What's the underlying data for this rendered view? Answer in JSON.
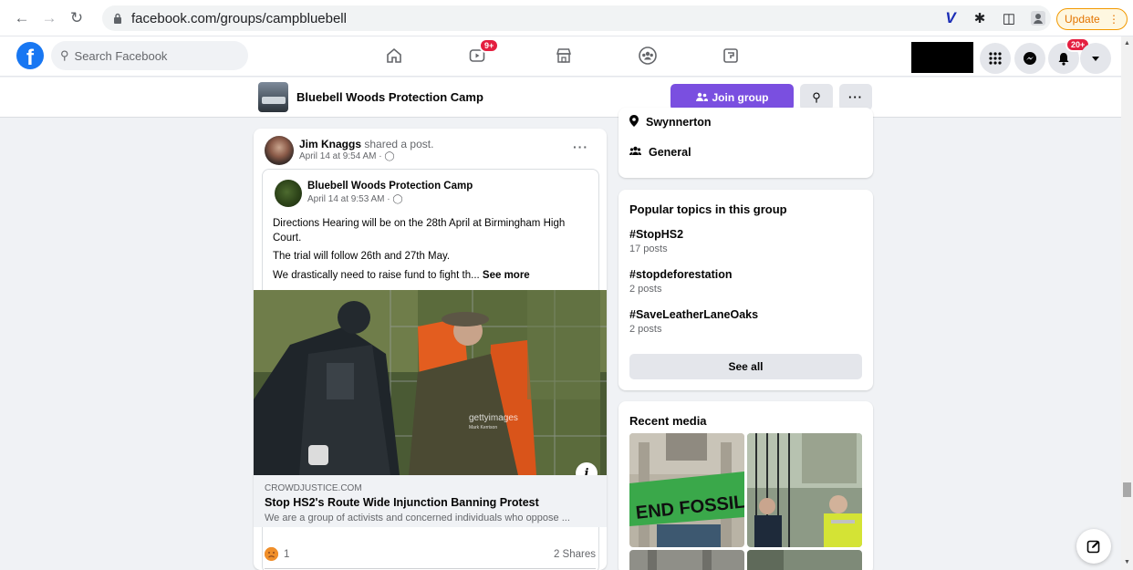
{
  "browser": {
    "url": "facebook.com/groups/campbluebell",
    "update_label": "Update"
  },
  "fb": {
    "search_placeholder": "Search Facebook",
    "watch_badge": "9+",
    "notif_badge": "20+"
  },
  "group": {
    "name": "Bluebell Woods Protection Camp",
    "join_label": "Join group"
  },
  "post": {
    "author": "Jim Knaggs",
    "action": "shared a post.",
    "time": "April 14 at 9:54 AM ·",
    "shared": {
      "author": "Bluebell Woods Protection Camp",
      "time": "April 14 at 9:53 AM ·",
      "text1": "Directions Hearing will be on the 28th April at Birmingham High Court.",
      "text2": "The trial will follow 26th and 27th May.",
      "text3": "We drastically need to raise fund to fight th...",
      "see_more": "See more"
    },
    "photo_watermark": "gettyimages",
    "photo_credit": "Mark Kerrison",
    "link": {
      "domain": "CROWDJUSTICE.COM",
      "title": "Stop HS2's Route Wide Injunction Banning Protest",
      "description": "We are a group of activists and concerned individuals who oppose ..."
    },
    "reaction_count": "1",
    "shares": "2 Shares"
  },
  "about": {
    "location": "Swynnerton",
    "category": "General"
  },
  "popular": {
    "title": "Popular topics in this group",
    "topics": [
      {
        "tag": "#StopHS2",
        "count": "17 posts"
      },
      {
        "tag": "#stopdeforestation",
        "count": "2 posts"
      },
      {
        "tag": "#SaveLeatherLaneOaks",
        "count": "2 posts"
      }
    ],
    "see_all": "See all"
  },
  "media": {
    "title": "Recent media",
    "banner_text": "END FOSSIL NOW"
  },
  "colors": {
    "fb_blue": "#1877f2",
    "join_purple": "#7a4fe0",
    "badge_red": "#e41e3f",
    "update_orange": "#e37400"
  }
}
